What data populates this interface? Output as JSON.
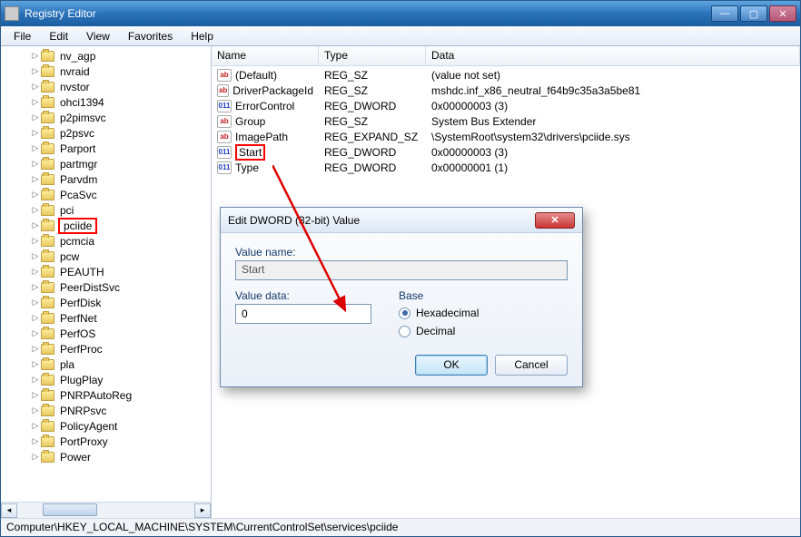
{
  "window": {
    "title": "Registry Editor",
    "menu": {
      "file": "File",
      "edit": "Edit",
      "view": "View",
      "favorites": "Favorites",
      "help": "Help"
    }
  },
  "tree": {
    "items": [
      "nv_agp",
      "nvraid",
      "nvstor",
      "ohci1394",
      "p2pimsvc",
      "p2psvc",
      "Parport",
      "partmgr",
      "Parvdm",
      "PcaSvc",
      "pci",
      "pciide",
      "pcmcia",
      "pcw",
      "PEAUTH",
      "PeerDistSvc",
      "PerfDisk",
      "PerfNet",
      "PerfOS",
      "PerfProc",
      "pla",
      "PlugPlay",
      "PNRPAutoReg",
      "PNRPsvc",
      "PolicyAgent",
      "PortProxy",
      "Power"
    ],
    "selected_index": 11
  },
  "list": {
    "headers": {
      "name": "Name",
      "type": "Type",
      "data": "Data"
    },
    "rows": [
      {
        "icon": "sz",
        "name": "(Default)",
        "type": "REG_SZ",
        "data": "(value not set)",
        "selected": false
      },
      {
        "icon": "sz",
        "name": "DriverPackageId",
        "type": "REG_SZ",
        "data": "mshdc.inf_x86_neutral_f64b9c35a3a5be81",
        "selected": false
      },
      {
        "icon": "dw",
        "name": "ErrorControl",
        "type": "REG_DWORD",
        "data": "0x00000003 (3)",
        "selected": false
      },
      {
        "icon": "sz",
        "name": "Group",
        "type": "REG_SZ",
        "data": "System Bus Extender",
        "selected": false
      },
      {
        "icon": "sz",
        "name": "ImagePath",
        "type": "REG_EXPAND_SZ",
        "data": "\\SystemRoot\\system32\\drivers\\pciide.sys",
        "selected": false
      },
      {
        "icon": "dw",
        "name": "Start",
        "type": "REG_DWORD",
        "data": "0x00000003 (3)",
        "selected": true
      },
      {
        "icon": "dw",
        "name": "Type",
        "type": "REG_DWORD",
        "data": "0x00000001 (1)",
        "selected": false
      }
    ]
  },
  "dialog": {
    "title": "Edit DWORD (32-bit) Value",
    "label_name": "Value name:",
    "value_name": "Start",
    "label_data": "Value data:",
    "value_data": "0",
    "label_base": "Base",
    "radio_hex": "Hexadecimal",
    "radio_dec": "Decimal",
    "ok": "OK",
    "cancel": "Cancel"
  },
  "statusbar": {
    "path": "Computer\\HKEY_LOCAL_MACHINE\\SYSTEM\\CurrentControlSet\\services\\pciide"
  },
  "icons": {
    "sz_glyph": "ab",
    "dw_glyph": "011"
  }
}
